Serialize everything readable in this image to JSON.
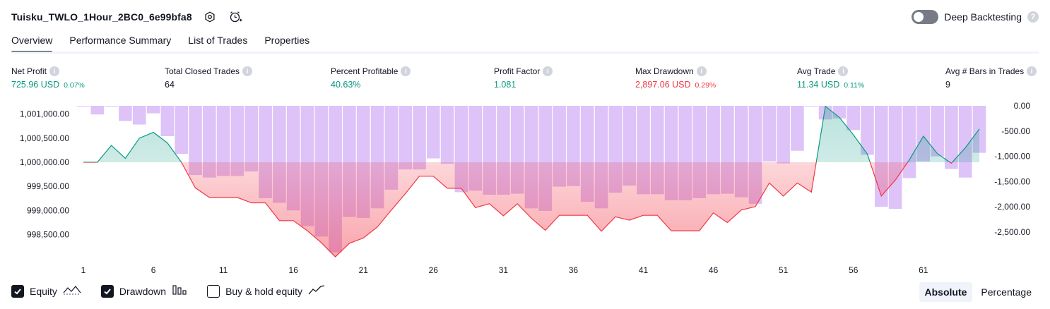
{
  "header": {
    "strategy_name": "Tuisku_TWLO_1Hour_2BC0_6e99bfa8",
    "settings_icon": "gear-icon",
    "alert_icon": "alarm-add-icon",
    "deep_backtesting_label": "Deep Backtesting",
    "deep_backtesting_enabled": false
  },
  "tabs": [
    {
      "label": "Overview",
      "active": true
    },
    {
      "label": "Performance Summary",
      "active": false
    },
    {
      "label": "List of Trades",
      "active": false
    },
    {
      "label": "Properties",
      "active": false
    }
  ],
  "stats": [
    {
      "label": "Net Profit",
      "value": "725.96 USD",
      "pct": "0.07%",
      "color": "#089981"
    },
    {
      "label": "Total Closed Trades",
      "value": "64",
      "pct": "",
      "color": "#131722"
    },
    {
      "label": "Percent Profitable",
      "value": "40.63%",
      "pct": "",
      "color": "#089981"
    },
    {
      "label": "Profit Factor",
      "value": "1.081",
      "pct": "",
      "color": "#089981"
    },
    {
      "label": "Max Drawdown",
      "value": "2,897.06 USD",
      "pct": "0.29%",
      "color": "#f23645"
    },
    {
      "label": "Avg Trade",
      "value": "11.34 USD",
      "pct": "0.11%",
      "color": "#089981"
    },
    {
      "label": "Avg # Bars in Trades",
      "value": "9",
      "pct": "",
      "color": "#131722"
    }
  ],
  "chart_data": {
    "type": "line",
    "x_ticks": [
      "1",
      "6",
      "11",
      "16",
      "21",
      "26",
      "31",
      "36",
      "41",
      "46",
      "51",
      "56",
      "61"
    ],
    "left_axis": {
      "ticks": [
        "1,001,000.00",
        "1,000,500.00",
        "1,000,000.00",
        "999,500.00",
        "999,000.00",
        "998,500.00"
      ],
      "ylim": [
        998000,
        1001200
      ]
    },
    "right_axis": {
      "ticks": [
        "0.00",
        "-500.00",
        "-1,000.00",
        "-1,500.00",
        "-2,000.00",
        "-2,500.00"
      ],
      "ylim": [
        -2900,
        0
      ]
    },
    "baseline": 1000000,
    "series": [
      {
        "name": "Equity",
        "color_up": "#089981",
        "color_down": "#f23645",
        "x": [
          1,
          2,
          3,
          4,
          5,
          6,
          7,
          8,
          9,
          10,
          11,
          12,
          13,
          14,
          15,
          16,
          17,
          18,
          19,
          20,
          21,
          22,
          23,
          24,
          25,
          26,
          27,
          28,
          29,
          30,
          31,
          32,
          33,
          34,
          35,
          36,
          37,
          38,
          39,
          40,
          41,
          42,
          43,
          44,
          45,
          46,
          47,
          48,
          49,
          50,
          51,
          52,
          53,
          54,
          55,
          56,
          57,
          58,
          59,
          60,
          61,
          62,
          63,
          64,
          65
        ],
        "values": [
          1000000,
          1000000,
          1000350,
          1000080,
          1000500,
          1000620,
          1000400,
          1000000,
          999470,
          999270,
          999270,
          999270,
          999160,
          999160,
          998790,
          998790,
          998580,
          998330,
          998040,
          998320,
          998430,
          998660,
          999010,
          999350,
          999710,
          999710,
          999460,
          999460,
          999060,
          999140,
          998890,
          999140,
          998840,
          998590,
          998900,
          998900,
          998900,
          998570,
          998870,
          998800,
          998900,
          998900,
          998580,
          998580,
          998580,
          998950,
          998750,
          999010,
          999080,
          999570,
          999300,
          999570,
          999380,
          1001160,
          1000930,
          1000570,
          1000170,
          999300,
          999630,
          1000050,
          1000540,
          1000180,
          999980,
          1000300,
          1000690
        ]
      },
      {
        "name": "Drawdown",
        "values": [
          0,
          -170,
          -10,
          -300,
          -370,
          -150,
          -600,
          -950,
          -1370,
          -1420,
          -1390,
          -1390,
          -1300,
          -1830,
          -1920,
          -2070,
          -2380,
          -2590,
          -2900,
          -2200,
          -2220,
          -2030,
          -1660,
          -1260,
          -1260,
          -1040,
          -1150,
          -1710,
          -1680,
          -1760,
          -1760,
          -1740,
          -2030,
          -2080,
          -1600,
          -1590,
          -1900,
          -2030,
          -1720,
          -1580,
          -1750,
          -1750,
          -1870,
          -1870,
          -1830,
          -1750,
          -1740,
          -1810,
          -1940,
          -1100,
          -1140,
          -890,
          0,
          -270,
          -250,
          -480,
          -970,
          -2000,
          -2040,
          -1430,
          -1100,
          -1000,
          -1250,
          -1420,
          -930
        ]
      }
    ]
  },
  "legend": [
    {
      "label": "Equity",
      "checked": true,
      "icon": "equity-line-icon"
    },
    {
      "label": "Drawdown",
      "checked": true,
      "icon": "drawdown-bars-icon"
    },
    {
      "label": "Buy & hold equity",
      "checked": false,
      "icon": "buy-hold-line-icon"
    }
  ],
  "scale_toggle": {
    "absolute": "Absolute",
    "percentage": "Percentage",
    "selected": "absolute"
  }
}
